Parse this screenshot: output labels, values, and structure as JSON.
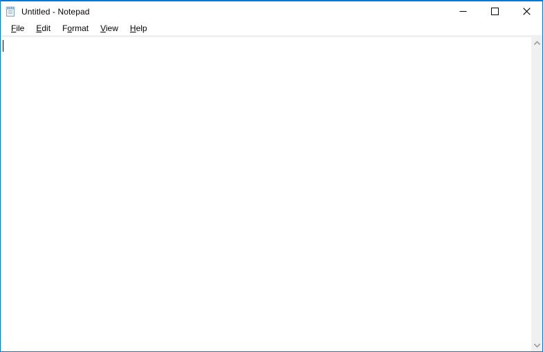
{
  "window": {
    "title": "Untitled - Notepad",
    "icon": "notepad-icon",
    "accent_color": "#0078d7",
    "background_color": "#ffffff"
  },
  "caption_buttons": [
    {
      "name": "minimize-button",
      "label": "Minimize",
      "glyph": "minimize-icon"
    },
    {
      "name": "maximize-button",
      "label": "Maximize",
      "glyph": "maximize-icon"
    },
    {
      "name": "close-button",
      "label": "Close",
      "glyph": "close-icon"
    }
  ],
  "menubar": {
    "items": [
      {
        "label": "File",
        "pre": "",
        "acc": "F",
        "post": "ile"
      },
      {
        "label": "Edit",
        "pre": "",
        "acc": "E",
        "post": "dit"
      },
      {
        "label": "Format",
        "pre": "F",
        "acc": "o",
        "post": "rmat"
      },
      {
        "label": "View",
        "pre": "",
        "acc": "V",
        "post": "iew"
      },
      {
        "label": "Help",
        "pre": "",
        "acc": "H",
        "post": "elp"
      }
    ]
  },
  "editor": {
    "content": "",
    "caret_visible": true,
    "word_wrap": false
  },
  "scrollbar": {
    "vertical": {
      "up_arrow": "chevron-up-icon",
      "down_arrow": "chevron-down-icon",
      "track_color": "#f0f0f0",
      "arrow_color": "#a0a0a0"
    }
  }
}
